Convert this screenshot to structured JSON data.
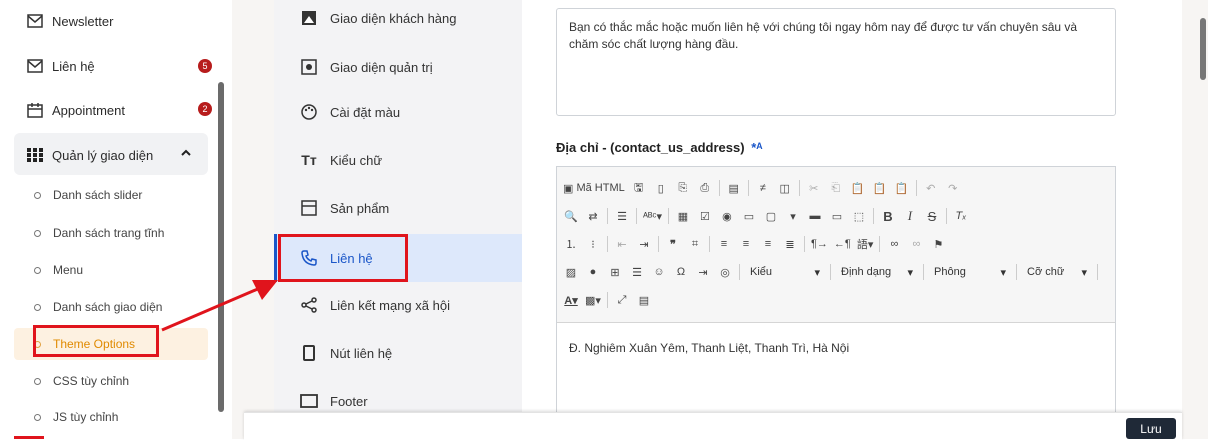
{
  "sidebar": {
    "items": [
      {
        "label": "Newsletter",
        "icon": "mail-icon"
      },
      {
        "label": "Liên hệ",
        "icon": "mail-icon",
        "badge": "5"
      },
      {
        "label": "Appointment",
        "icon": "calendar-icon",
        "badge": "2"
      },
      {
        "label": "Quản lý giao diện",
        "icon": "grid-icon",
        "expanded": true
      }
    ],
    "subitems": [
      {
        "label": "Danh sách slider"
      },
      {
        "label": "Danh sách trang tĩnh"
      },
      {
        "label": "Menu"
      },
      {
        "label": "Danh sách giao diện"
      },
      {
        "label": "Theme Options",
        "active": true
      },
      {
        "label": "CSS tùy chỉnh"
      },
      {
        "label": "JS tùy chỉnh"
      }
    ]
  },
  "options_menu": {
    "items": [
      {
        "label": "Giao diện khách hàng",
        "icon": "user-app-icon"
      },
      {
        "label": "Giao diện quản trị",
        "icon": "admin-app-icon"
      },
      {
        "label": "Cài đặt màu",
        "icon": "palette-icon"
      },
      {
        "label": "Kiểu chữ",
        "icon": "text-type-icon"
      },
      {
        "label": "Sản phẩm",
        "icon": "product-icon"
      },
      {
        "label": "Liên hệ",
        "icon": "phone-icon",
        "active": true
      },
      {
        "label": "Liên kết mạng xã hội",
        "icon": "share-icon"
      },
      {
        "label": "Nút liên hệ",
        "icon": "mobile-icon"
      },
      {
        "label": "Footer",
        "icon": "footer-icon"
      }
    ]
  },
  "content": {
    "intro_text": "Bạn có thắc mắc hoặc muốn liên hệ với chúng tôi ngay hôm nay để được tư vấn chuyên sâu và chăm sóc chất lượng hàng đầu.",
    "address_label": "Địa chỉ - (contact_us_address)",
    "address_value": "Đ. Nghiêm Xuân Yêm, Thanh Liệt, Thanh Trì, Hà Nội",
    "toolbar": {
      "source_label": "Mã HTML",
      "styles_label": "Kiểu",
      "format_label": "Định dạng",
      "font_label": "Phông",
      "size_label": "Cỡ chữ"
    }
  },
  "footer": {
    "save_label": "Lưu"
  },
  "colors": {
    "accent": "#1a56c8",
    "badge": "#b71c1c",
    "annotation": "#e0141c"
  }
}
